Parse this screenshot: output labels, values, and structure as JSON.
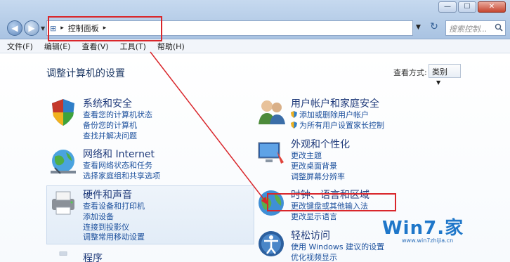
{
  "window": {
    "minimize_glyph": "—",
    "maximize_glyph": "☐",
    "close_glyph": "✕"
  },
  "address": {
    "root_glyph": "⊞",
    "crumb": "控制面板",
    "search_placeholder": "搜索控制..."
  },
  "menu": [
    "文件(F)",
    "编辑(E)",
    "查看(V)",
    "工具(T)",
    "帮助(H)"
  ],
  "main": {
    "title": "调整计算机的设置",
    "view_label": "查看方式:",
    "view_value": "类别"
  },
  "categories": {
    "system": {
      "title": "系统和安全",
      "links": [
        "查看您的计算机状态",
        "备份您的计算机",
        "查找并解决问题"
      ]
    },
    "network": {
      "title": "网络和 Internet",
      "links": [
        "查看网络状态和任务",
        "选择家庭组和共享选项"
      ]
    },
    "hardware": {
      "title": "硬件和声音",
      "links": [
        "查看设备和打印机",
        "添加设备",
        "连接到投影仪",
        "调整常用移动设置"
      ]
    },
    "programs": {
      "title": "程序"
    },
    "users": {
      "title": "用户帐户和家庭安全",
      "links": [
        "添加或删除用户帐户",
        "为所有用户设置家长控制"
      ]
    },
    "appearance": {
      "title": "外观和个性化",
      "links": [
        "更改主题",
        "更改桌面背景",
        "调整屏幕分辨率"
      ]
    },
    "clock": {
      "title": "时钟、语言和区域",
      "links": [
        "更改键盘或其他输入法",
        "更改显示语言"
      ]
    },
    "ease": {
      "title": "轻松访问",
      "links": [
        "使用 Windows 建议的设置",
        "优化视频显示"
      ]
    }
  },
  "watermark": {
    "text": "Win7.家",
    "url": "www.win7zhijia.cn"
  },
  "colors": {
    "annotation": "#d9262b",
    "link": "#1b4f9c",
    "heading": "#1f3a7a"
  }
}
